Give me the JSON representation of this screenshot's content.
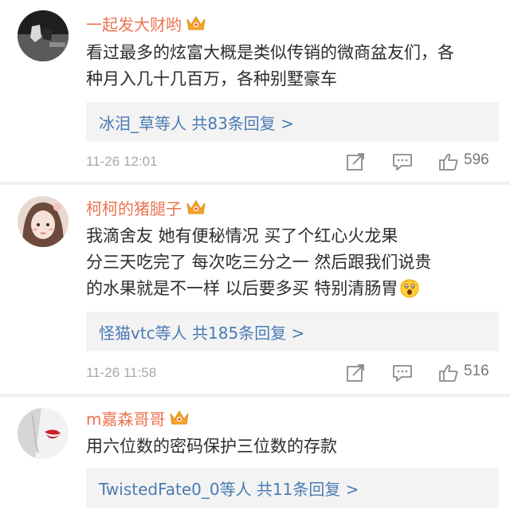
{
  "comments": [
    {
      "username": "一起发大财哟",
      "content_lines": [
        "看过最多的炫富大概是类似传销的微商盆友们，各",
        "种月入几十几百万，各种别墅豪车"
      ],
      "reply_summary": "冰泪_草等人 共83条回复 >",
      "timestamp": "11-26 12:01",
      "likes": "596",
      "avatar_icon": "avatar-photo-icon"
    },
    {
      "username": "柯柯的猪腿子",
      "content_lines": [
        "我滴舍友    她有便秘情况   买了个红心火龙果",
        "分三天吃完了  每次吃三分之一  然后跟我们说贵",
        "的水果就是不一样  以后要多买  特别清肠胃"
      ],
      "reply_summary": "怪猫vtc等人 共185条回复 >",
      "timestamp": "11-26 11:58",
      "likes": "516",
      "avatar_icon": "avatar-photo-icon"
    },
    {
      "username": "m嘉森哥哥",
      "content_lines": [
        "用六位数的密码保护三位数的存款"
      ],
      "reply_summary": "TwistedFate0_0等人 共11条回复 >",
      "avatar_icon": "avatar-photo-icon"
    }
  ],
  "icons": {
    "crown": "crown-icon",
    "forward": "forward-icon",
    "reply": "reply-icon",
    "like": "thumbs-up-icon",
    "emoji": "scared-face-emoji-icon"
  },
  "colors": {
    "username": "#eb7350",
    "link": "#4a7bb4",
    "text": "#2d2d2d",
    "meta": "#a8a8a8",
    "reply_bg": "#f3f3f3",
    "crown": "#f5a623"
  }
}
